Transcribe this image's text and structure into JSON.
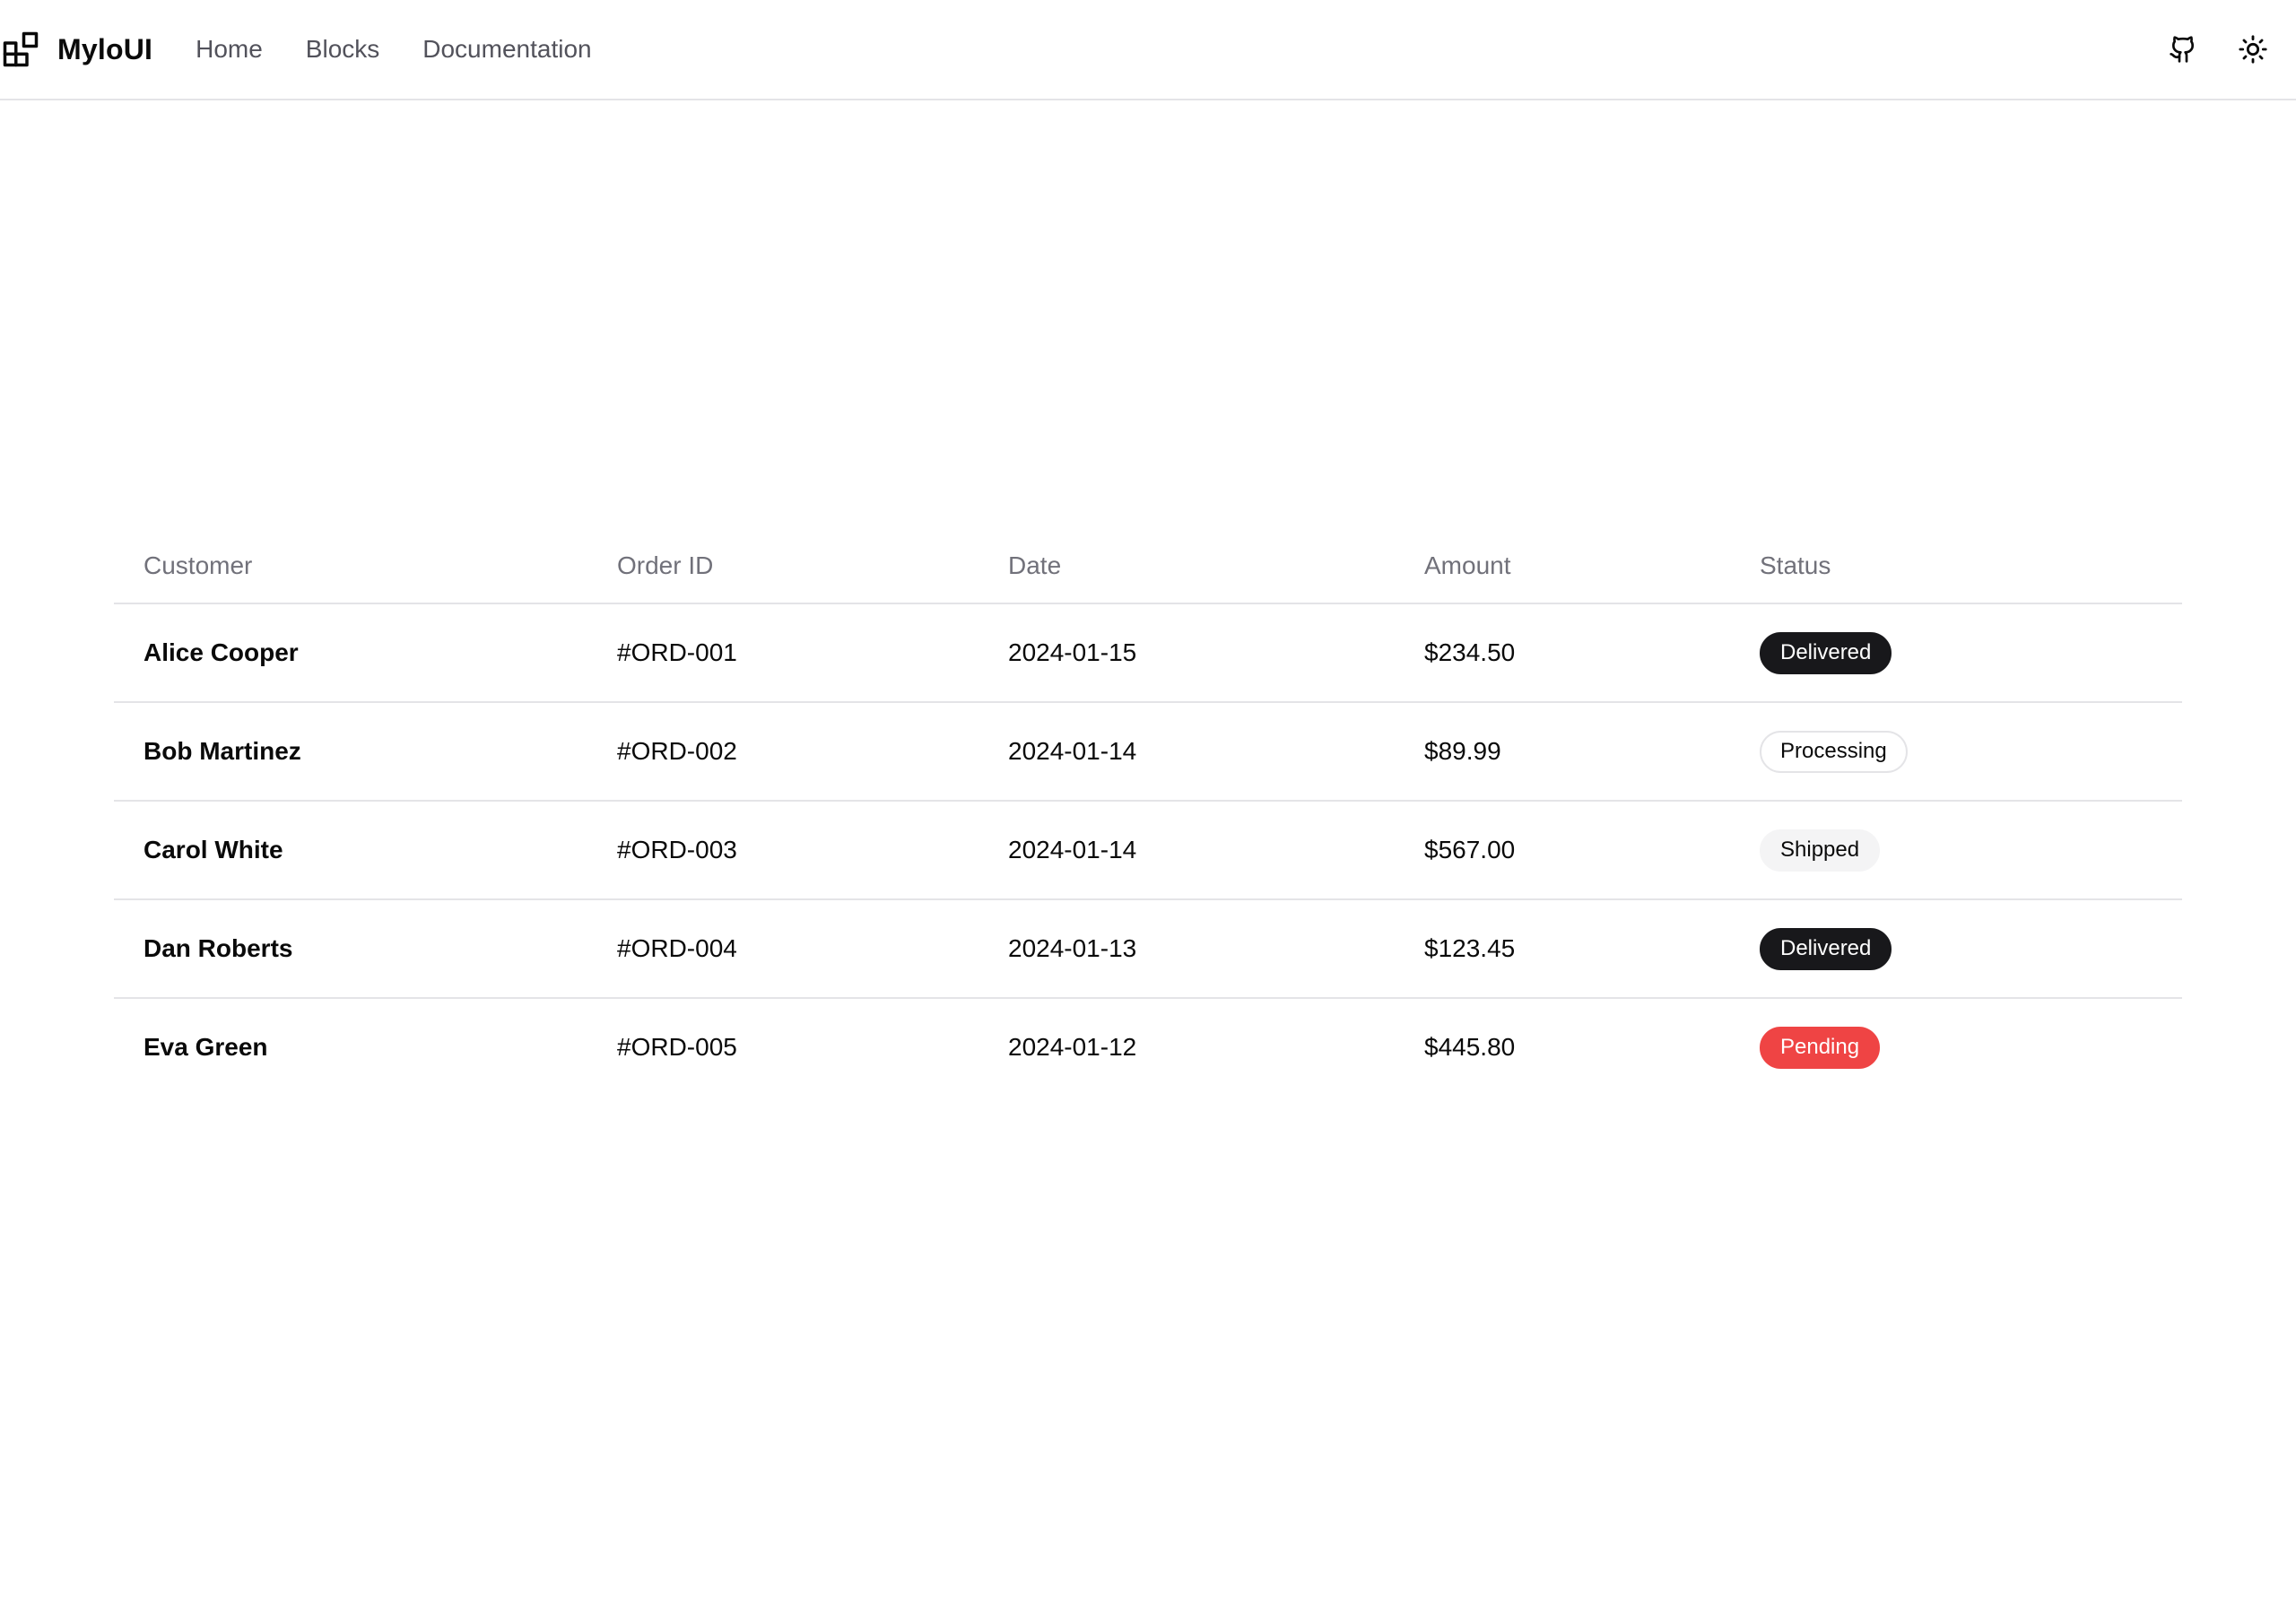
{
  "header": {
    "brand": "MyloUI",
    "nav": [
      "Home",
      "Blocks",
      "Documentation"
    ],
    "actions": {
      "github_icon": "github-icon",
      "theme_icon": "sun-icon"
    }
  },
  "table": {
    "columns": [
      "Customer",
      "Order ID",
      "Date",
      "Amount",
      "Status"
    ],
    "rows": [
      {
        "customer": "Alice Cooper",
        "order_id": "#ORD-001",
        "date": "2024-01-15",
        "amount": "$234.50",
        "status": "Delivered",
        "status_variant": "delivered"
      },
      {
        "customer": "Bob Martinez",
        "order_id": "#ORD-002",
        "date": "2024-01-14",
        "amount": "$89.99",
        "status": "Processing",
        "status_variant": "processing"
      },
      {
        "customer": "Carol White",
        "order_id": "#ORD-003",
        "date": "2024-01-14",
        "amount": "$567.00",
        "status": "Shipped",
        "status_variant": "shipped"
      },
      {
        "customer": "Dan Roberts",
        "order_id": "#ORD-004",
        "date": "2024-01-13",
        "amount": "$123.45",
        "status": "Delivered",
        "status_variant": "delivered"
      },
      {
        "customer": "Eva Green",
        "order_id": "#ORD-005",
        "date": "2024-01-12",
        "amount": "$445.80",
        "status": "Pending",
        "status_variant": "pending"
      }
    ]
  },
  "colors": {
    "delivered_bg": "#18181b",
    "pending_bg": "#ef4444",
    "shipped_bg": "#f4f4f5",
    "border": "#e4e4e7",
    "muted_text": "#71717a"
  }
}
